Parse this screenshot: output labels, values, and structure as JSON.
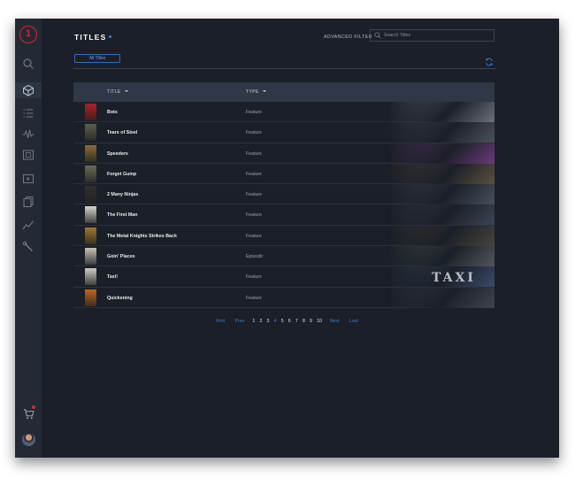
{
  "app": {
    "logo_text": "1"
  },
  "header": {
    "title": "TITLES",
    "advanced_filter_label": "ADVANCED FILTER",
    "search_placeholder": "Search Titles",
    "filter_chip_label": "All Titles"
  },
  "sidebar": {
    "items": [
      {
        "icon": "search-icon"
      },
      {
        "icon": "cube-icon",
        "active": true
      },
      {
        "icon": "list-icon"
      },
      {
        "icon": "waveform-icon"
      },
      {
        "icon": "film-frame-icon"
      },
      {
        "icon": "media-box-icon"
      },
      {
        "icon": "copy-icon"
      },
      {
        "icon": "line-chart-icon"
      },
      {
        "icon": "wrench-icon"
      }
    ],
    "cart_icon": "cart-icon",
    "cart_badge_color": "#e0262e"
  },
  "table": {
    "columns": [
      "TITLE",
      "TYPE"
    ],
    "rows": [
      {
        "title": "Bots",
        "type": "Feature",
        "poster_color": "#b31e24",
        "backdrop_color": "#6a6f78"
      },
      {
        "title": "Tears of Steel",
        "type": "Feature",
        "poster_color": "#5b5f4a",
        "backdrop_color": "#4c5058"
      },
      {
        "title": "Speeders",
        "type": "Feature",
        "poster_color": "#8a6a3a",
        "backdrop_color": "#6a3a7a"
      },
      {
        "title": "Forget Gump",
        "type": "Feature",
        "poster_color": "#6a6a52",
        "backdrop_color": "#5a5040"
      },
      {
        "title": "2 Many Ninjas",
        "type": "Feature",
        "poster_color": "#2e2e2e",
        "backdrop_color": "#48505c"
      },
      {
        "title": "The First Man",
        "type": "Feature",
        "poster_color": "#d8d4c8",
        "backdrop_color": "#3c4654"
      },
      {
        "title": "The Metal Knights Strikes Back",
        "type": "Feature",
        "poster_color": "#a0782e",
        "backdrop_color": "#48443e"
      },
      {
        "title": "Goin' Places",
        "type": "Episodic",
        "poster_color": "#c8c2b4",
        "backdrop_color": "#52565c"
      },
      {
        "title": "Taxi!",
        "type": "Feature",
        "poster_color": "#d0ccc0",
        "backdrop_color": "#3a4a6a",
        "backdrop_text": "TAXI"
      },
      {
        "title": "Quickening",
        "type": "Feature",
        "poster_color": "#c0641e",
        "backdrop_color": "#40444c"
      }
    ]
  },
  "pagination": {
    "first": "First",
    "prev": "Prev",
    "pages": [
      "1",
      "2",
      "3",
      "4",
      "5",
      "6",
      "7",
      "8",
      "9",
      "10"
    ],
    "current_page": "4",
    "next": "Next",
    "last": "Last"
  },
  "colors": {
    "accent": "#2f7fdc",
    "brand": "#d6262e",
    "background": "#1b1f27",
    "sidebar": "#232a35"
  }
}
